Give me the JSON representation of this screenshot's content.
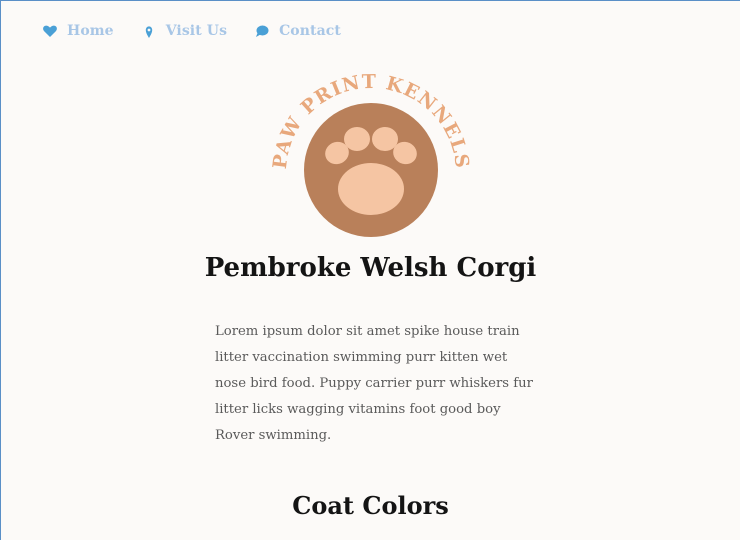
{
  "nav": {
    "items": [
      {
        "label": "Home",
        "icon": "heart-icon",
        "color": "#4aa0d6"
      },
      {
        "label": "Visit Us",
        "icon": "map-pin-icon",
        "color": "#4aa0d6"
      },
      {
        "label": "Contact",
        "icon": "chat-bubble-icon",
        "color": "#4aa0d6"
      }
    ]
  },
  "logo": {
    "text": "PAW PRINT KENNELS",
    "text_color": "#e8a87c",
    "circle_color": "#b9805a",
    "paw_color": "#f5c5a3"
  },
  "main": {
    "title": "Pembroke Welsh Corgi",
    "intro": "Lorem ipsum dolor sit amet spike house train litter vaccination swimming purr kitten wet nose bird food. Puppy carrier purr whiskers fur litter licks wagging vitamins foot good boy Rover swimming.",
    "section_title": "Coat Colors"
  }
}
